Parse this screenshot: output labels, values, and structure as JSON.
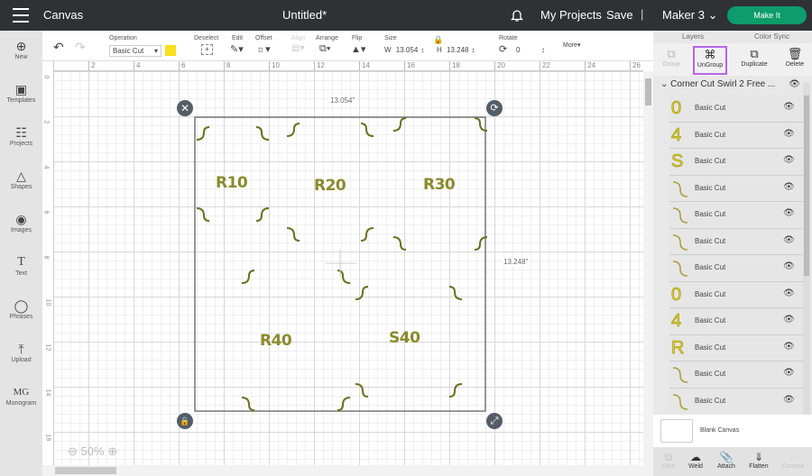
{
  "topbar": {
    "app_name": "Canvas",
    "title": "Untitled*",
    "my_projects": "My Projects",
    "save": "Save",
    "separator": "|",
    "machine": "Maker 3",
    "make_it": "Make It",
    "make_it_color": "#0d9c6b"
  },
  "leftbar": {
    "items": [
      {
        "label": "New",
        "icon": "plus-circle-icon"
      },
      {
        "label": "Templates",
        "icon": "shirt-icon"
      },
      {
        "label": "Projects",
        "icon": "clipboard-icon"
      },
      {
        "label": "Shapes",
        "icon": "shapes-icon"
      },
      {
        "label": "Images",
        "icon": "bulb-icon"
      },
      {
        "label": "Text",
        "icon": "text-icon"
      },
      {
        "label": "Phrases",
        "icon": "speech-bubble-icon"
      },
      {
        "label": "Upload",
        "icon": "upload-icon"
      },
      {
        "label": "Monogram",
        "icon": "monogram-icon"
      }
    ]
  },
  "toolbar": {
    "operation_label": "Operation",
    "operation_value": "Basic Cut",
    "operation_color": "#f7e01d",
    "deselect": "Deselect",
    "edit": "Edit",
    "offset": "Offset",
    "align": "Align",
    "arrange": "Arrange",
    "flip": "Flip",
    "size_label": "Size",
    "w_label": "W",
    "w_value": "13.054",
    "h_label": "H",
    "h_value": "13.248",
    "rotate_label": "Rotate",
    "rotate_value": "0",
    "more": "More"
  },
  "rulers": {
    "top": [
      "2",
      "4",
      "6",
      "8",
      "10",
      "12",
      "14",
      "16",
      "18",
      "20",
      "22",
      "24",
      "26"
    ],
    "left": [
      "0",
      "2",
      "4",
      "6",
      "8",
      "10",
      "12",
      "14",
      "16"
    ]
  },
  "canvas": {
    "width_readout": "13.054\"",
    "height_readout": "13.248\"",
    "labels": [
      "R10",
      "R20",
      "R30",
      "R40",
      "S40"
    ],
    "zoom": "50%",
    "shape_color": "#7a7a2a"
  },
  "rightpanel": {
    "tabs": [
      "Layers",
      "Color Sync"
    ],
    "actions": {
      "group": "Group",
      "ungroup": "UnGroup",
      "duplicate": "Duplicate",
      "delete": "Delete"
    },
    "group_name": "Corner Cut Swirl 2 Free ...",
    "layers": [
      {
        "thumb": "0",
        "name": "Basic Cut"
      },
      {
        "thumb": "4",
        "name": "Basic Cut"
      },
      {
        "thumb": "S",
        "name": "Basic Cut"
      },
      {
        "thumb": "swirl",
        "name": "Basic Cut"
      },
      {
        "thumb": "swirl",
        "name": "Basic Cut"
      },
      {
        "thumb": "swirl",
        "name": "Basic Cut"
      },
      {
        "thumb": "swirl",
        "name": "Basic Cut"
      },
      {
        "thumb": "0",
        "name": "Basic Cut"
      },
      {
        "thumb": "4",
        "name": "Basic Cut"
      },
      {
        "thumb": "R",
        "name": "Basic Cut"
      },
      {
        "thumb": "swirl",
        "name": "Basic Cut"
      },
      {
        "thumb": "swirl",
        "name": "Basic Cut"
      }
    ],
    "blank_canvas": "Blank Canvas",
    "bottom_actions": {
      "slice": "Slice",
      "weld": "Weld",
      "attach": "Attach",
      "flatten": "Flatten",
      "contour": "Contour"
    }
  }
}
